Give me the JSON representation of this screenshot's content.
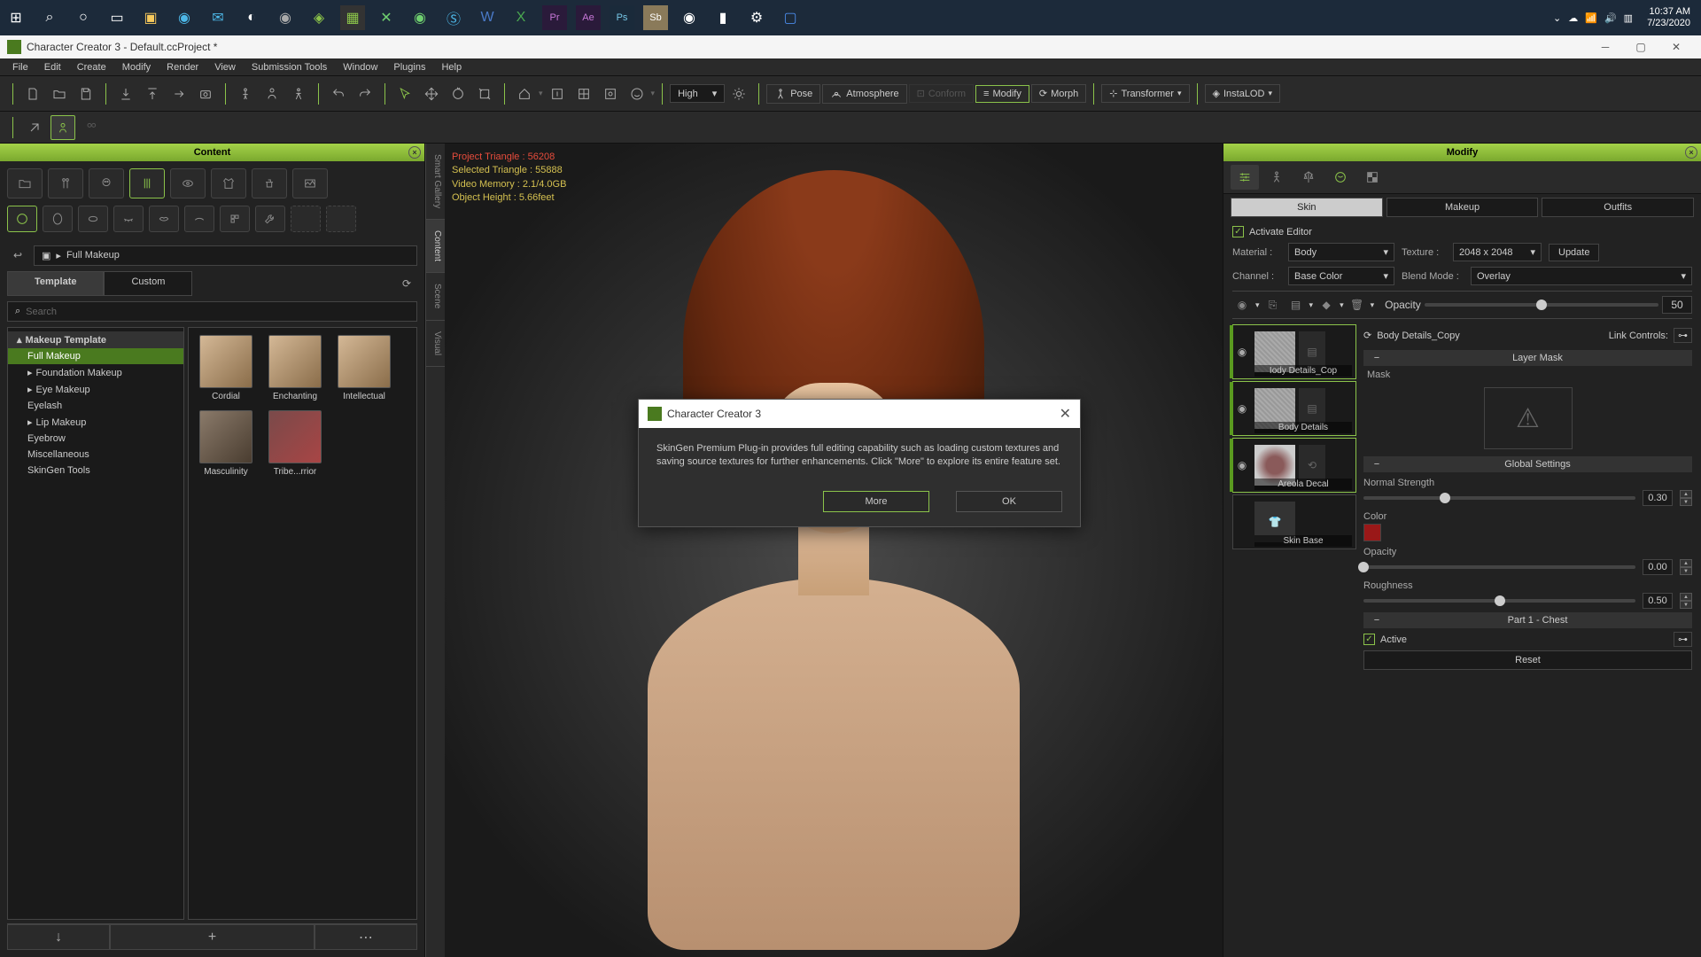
{
  "taskbar": {
    "time": "10:37 AM",
    "date": "7/23/2020"
  },
  "window": {
    "title": "Character Creator 3 - Default.ccProject *"
  },
  "menu": [
    "File",
    "Edit",
    "Create",
    "Modify",
    "Render",
    "View",
    "Submission Tools",
    "Window",
    "Plugins",
    "Help"
  ],
  "toolbar": {
    "quality": "High",
    "pose": "Pose",
    "atmo": "Atmosphere",
    "conform": "Conform",
    "modify": "Modify",
    "morph": "Morph",
    "transformer": "Transformer",
    "instalod": "InstaLOD"
  },
  "left": {
    "title": "Content",
    "side_tabs": [
      "Smart Gallery",
      "Content",
      "Scene",
      "Visual"
    ],
    "breadcrumb": "Full Makeup",
    "tabs": {
      "template": "Template",
      "custom": "Custom"
    },
    "search_placeholder": "Search",
    "tree": {
      "root": "Makeup Template",
      "items": [
        "Full Makeup",
        "Foundation Makeup",
        "Eye Makeup",
        "Eyelash",
        "Lip Makeup",
        "Eyebrow",
        "Miscellaneous",
        "SkinGen Tools"
      ]
    },
    "thumbs": [
      "Cordial",
      "Enchanting",
      "Intellectual",
      "Masculinity",
      "Tribe...rrior"
    ]
  },
  "viewport": {
    "stats": {
      "proj_tri": "Project Triangle : 56208",
      "sel_tri": "Selected Triangle : 55888",
      "vmem": "Video Memory : 2.1/4.0GB",
      "height": "Object Height : 5.66feet"
    }
  },
  "dialog": {
    "title": "Character Creator 3",
    "body": "SkinGen Premium Plug-in provides full editing capability such as loading custom textures and saving source textures for further enhancements. Click \"More\" to explore its entire feature set.",
    "more": "More",
    "ok": "OK"
  },
  "right": {
    "title": "Modify",
    "tabs": {
      "skin": "Skin",
      "makeup": "Makeup",
      "outfits": "Outfits"
    },
    "activate": "Activate Editor",
    "material_label": "Material :",
    "material": "Body",
    "texture_label": "Texture :",
    "texture": "2048 x 2048",
    "update": "Update",
    "channel_label": "Channel :",
    "channel": "Base Color",
    "blend_label": "Blend Mode :",
    "blend": "Overlay",
    "opacity_label": "Opacity",
    "opacity_val": "50",
    "layers": [
      "Iody Details_Cop",
      "Body Details",
      "Areola Decal",
      "Skin Base"
    ],
    "detail_name": "Body Details_Copy",
    "link_controls": "Link Controls:",
    "section_mask": "Layer Mask",
    "mask_label": "Mask",
    "section_global": "Global Settings",
    "normal_strength": "Normal Strength",
    "normal_val": "0.30",
    "color_label": "Color",
    "opacity2_label": "Opacity",
    "opacity2_val": "0.00",
    "rough_label": "Roughness",
    "rough_val": "0.50",
    "section_part1": "Part 1 - Chest",
    "active_label": "Active",
    "reset": "Reset"
  }
}
